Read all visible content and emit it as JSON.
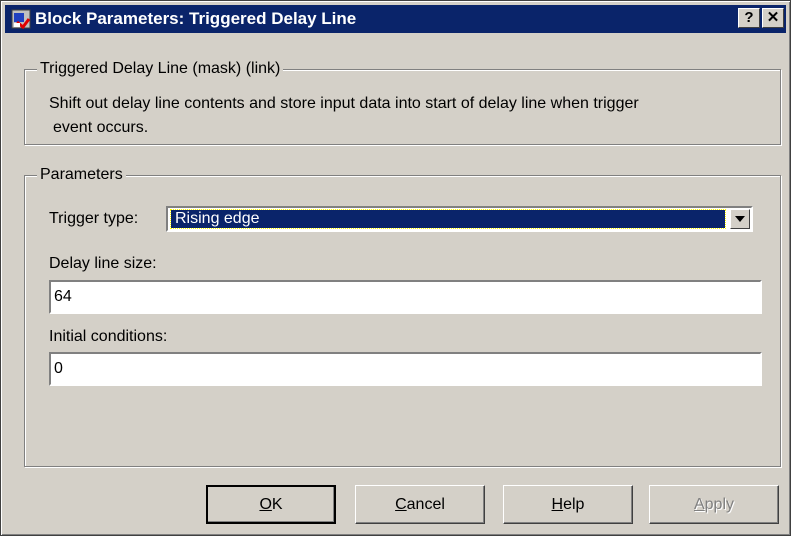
{
  "window": {
    "title": "Block Parameters: Triggered Delay Line",
    "help_glyph": "?",
    "close_glyph": "✕"
  },
  "description_group": {
    "legend": "Triggered Delay Line (mask) (link)",
    "line1": "Shift out delay line contents and store input data into start of delay line when trigger",
    "line2": "event occurs."
  },
  "parameters": {
    "legend": "Parameters",
    "trigger_type": {
      "label": "Trigger type:",
      "value": "Rising edge"
    },
    "delay_line_size": {
      "label": "Delay line size:",
      "value": "64"
    },
    "initial_conditions": {
      "label": "Initial conditions:",
      "value": "0"
    }
  },
  "buttons": {
    "ok": {
      "mnemonic": "O",
      "rest": "K"
    },
    "cancel": {
      "mnemonic": "C",
      "rest": "ancel"
    },
    "help": {
      "mnemonic": "H",
      "rest": "elp"
    },
    "apply": {
      "mnemonic": "A",
      "rest": "pply"
    }
  },
  "colors": {
    "titlebar": "#0a246a",
    "dialog_face": "#d4d0c8",
    "selection": "#0a246a"
  },
  "icons": [
    "simulink-block-icon",
    "help-icon",
    "close-icon",
    "dropdown-arrow-icon"
  ]
}
